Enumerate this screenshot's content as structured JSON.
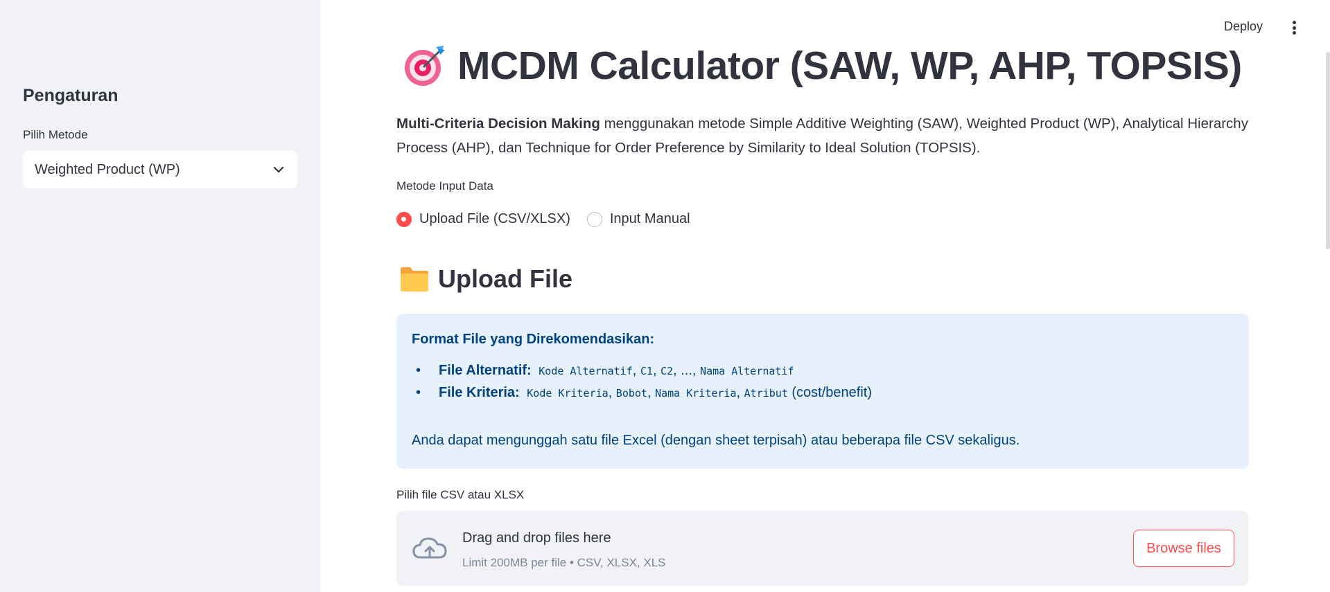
{
  "sidebar": {
    "title": "Pengaturan",
    "method_label": "Pilih Metode",
    "method_selected": "Weighted Product (WP)"
  },
  "header": {
    "deploy_label": "Deploy"
  },
  "main": {
    "title": "MCDM Calculator (SAW, WP, AHP, TOPSIS)",
    "desc_bold": "Multi-Criteria Decision Making",
    "desc_rest": " menggunakan metode Simple Additive Weighting (SAW), Weighted Product (WP), Analytical Hierarchy Process (AHP), dan Technique for Order Preference by Similarity to Ideal Solution (TOPSIS).",
    "input_method_label": "Metode Input Data",
    "radio_options": [
      {
        "label": "Upload File (CSV/XLSX)",
        "checked": true
      },
      {
        "label": "Input Manual",
        "checked": false
      }
    ],
    "upload_title": "Upload File",
    "info": {
      "heading": "Format File yang Direkomendasikan:",
      "alt_label": "File Alternatif:",
      "alt_codes": [
        "Kode Alternatif",
        "C1",
        "C2",
        "...",
        "Nama Alternatif"
      ],
      "crit_label": "File Kriteria:",
      "crit_codes": [
        "Kode Kriteria",
        "Bobot",
        "Nama Kriteria",
        "Atribut"
      ],
      "crit_suffix": "(cost/benefit)",
      "footer": "Anda dapat mengunggah satu file Excel (dengan sheet terpisah) atau beberapa file CSV sekaligus."
    },
    "file_label": "Pilih file CSV atau XLSX",
    "dropzone": {
      "main": "Drag and drop files here",
      "sub": "Limit 200MB per file • CSV, XLSX, XLS",
      "browse_label": "Browse files"
    }
  },
  "colors": {
    "accent": "#ff4b4b",
    "sidebar_bg": "#f0f2f6",
    "info_bg": "#e7f1fb",
    "info_text": "#004280"
  }
}
